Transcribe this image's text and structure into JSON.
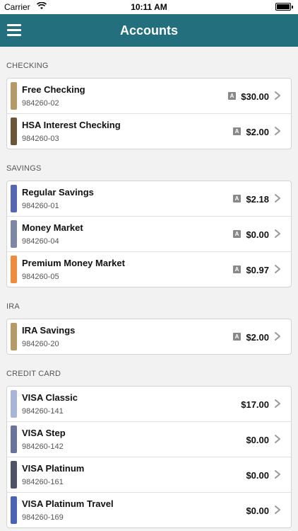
{
  "status_bar": {
    "carrier": "Carrier",
    "time": "10:11 AM"
  },
  "nav": {
    "title": "Accounts",
    "menu_icon": "hamburger-menu-icon"
  },
  "sections": [
    {
      "label": "CHECKING",
      "accounts": [
        {
          "name": "Free Checking",
          "number": "984260-02",
          "balance": "$30.00",
          "badge": "A",
          "color": "#b59a68"
        },
        {
          "name": "HSA Interest Checking",
          "number": "984260-03",
          "balance": "$2.00",
          "badge": "A",
          "color": "#6b5738"
        }
      ]
    },
    {
      "label": "SAVINGS",
      "accounts": [
        {
          "name": "Regular Savings",
          "number": "984260-01",
          "balance": "$2.18",
          "badge": "A",
          "color": "#5566b3"
        },
        {
          "name": "Money Market",
          "number": "984260-04",
          "balance": "$0.00",
          "badge": "A",
          "color": "#7e86a6"
        },
        {
          "name": "Premium Money Market",
          "number": "984260-05",
          "balance": "$0.97",
          "badge": "A",
          "color": "#f08a3c"
        }
      ]
    },
    {
      "label": "IRA",
      "accounts": [
        {
          "name": "IRA Savings",
          "number": "984260-20",
          "balance": "$2.00",
          "badge": "A",
          "color": "#b59a68"
        }
      ]
    },
    {
      "label": "CREDIT CARD",
      "accounts": [
        {
          "name": "VISA Classic",
          "number": "984260-141",
          "balance": "$17.00",
          "badge": "",
          "color": "#a9b4d9"
        },
        {
          "name": "VISA Step",
          "number": "984260-142",
          "balance": "$0.00",
          "badge": "",
          "color": "#6a7399"
        },
        {
          "name": "VISA Platinum",
          "number": "984260-161",
          "balance": "$0.00",
          "badge": "",
          "color": "#4e5466"
        },
        {
          "name": "VISA Platinum Travel",
          "number": "984260-169",
          "balance": "$0.00",
          "badge": "",
          "color": "#4b63b5"
        }
      ]
    }
  ]
}
